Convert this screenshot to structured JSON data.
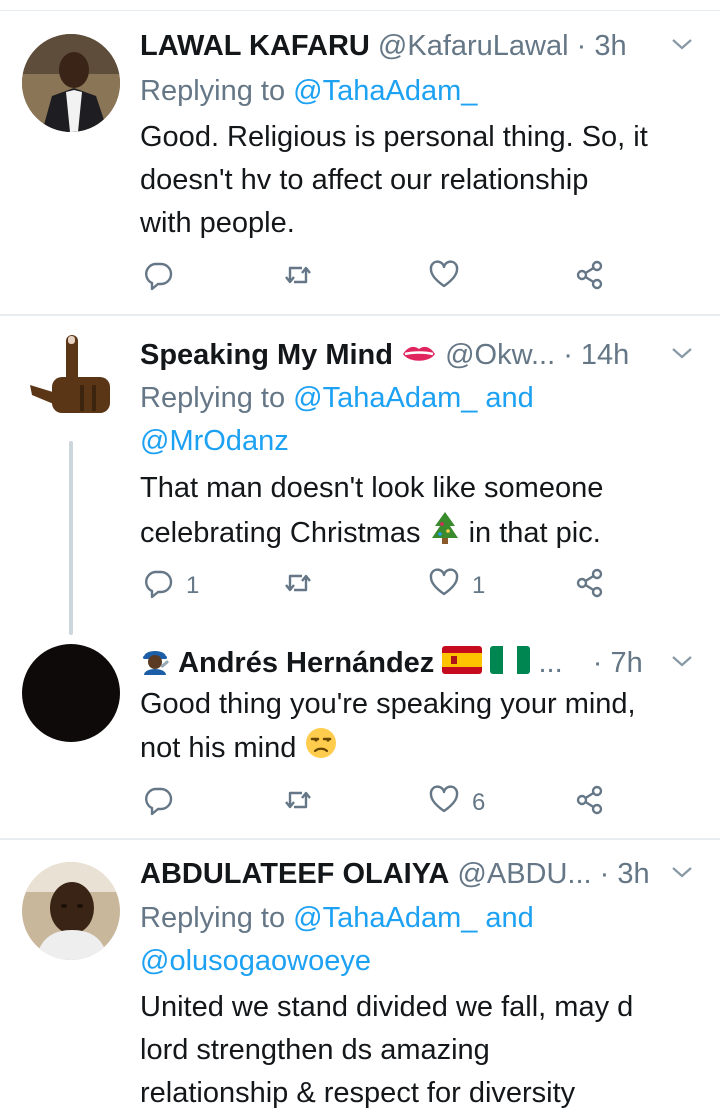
{
  "tweets": [
    {
      "name": "LAWAL KAFARU",
      "handle": "@KafaruLawal",
      "time": "3h",
      "replying_prefix": "Replying to",
      "replying_to": "@TahaAdam_",
      "text_lines": [
        "Good. Religious is personal thing. So, it",
        "doesn't hv to affect our relationship",
        "with people."
      ],
      "reply_count": "",
      "retweet_count": "",
      "like_count": ""
    },
    {
      "name": "Speaking My Mind",
      "handle": "@Okw...",
      "time": "14h",
      "replying_prefix": "Replying to",
      "replying_to": "@TahaAdam_ and",
      "replying_to_2": "@MrOdanz",
      "text_lines": [
        "That man doesn't look like someone",
        "celebrating Christmas",
        "in that pic."
      ],
      "reply_count": "1",
      "retweet_count": "",
      "like_count": "1"
    },
    {
      "name": "Andrés Hernández",
      "handle": "...",
      "time": "7h",
      "text_lines": [
        "Good thing you're speaking your mind,",
        "not his mind"
      ],
      "reply_count": "",
      "retweet_count": "",
      "like_count": "6"
    },
    {
      "name": "ABDULATEEF OLAIYA",
      "handle": "@ABDU...",
      "time": "3h",
      "replying_prefix": "Replying to",
      "replying_to": "@TahaAdam_ and",
      "replying_to_2": "@olusogaowoeye",
      "text_lines": [
        "United we stand divided we fall, may d",
        "lord strengthen ds amazing",
        "relationship & respect for diversity"
      ]
    }
  ],
  "dot": "·",
  "colors": {
    "accent": "#1da1f2",
    "secondary": "#657786",
    "divider": "#e6ecf0"
  },
  "icons": [
    "reply-icon",
    "retweet-icon",
    "like-icon",
    "share-icon",
    "chevron-down-icon"
  ]
}
